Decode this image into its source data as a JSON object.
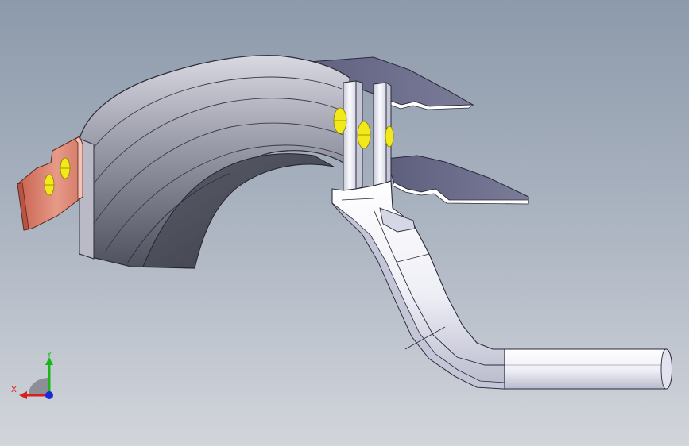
{
  "viewport": {
    "background_top": "#8d9aab",
    "background_bottom": "#d2d5db"
  },
  "model": {
    "body_color": "#8f909c",
    "bus_bar_color": "#f2f1f6",
    "contact_tab_color": "#d97a68",
    "fastener_color": "#f2e91b",
    "finger_color": "#686a88"
  },
  "triad": {
    "x_label": "X",
    "y_label": "Y",
    "x_color": "#d42020",
    "y_color": "#18b818",
    "z_color": "#1a2ad8"
  }
}
